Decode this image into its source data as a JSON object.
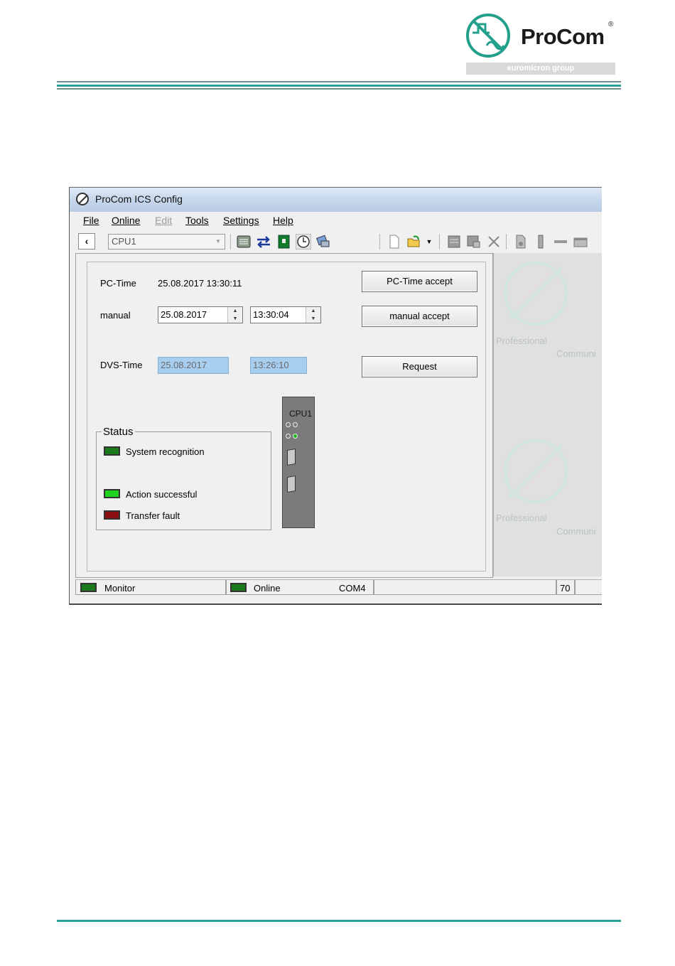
{
  "document": {
    "logo_name": "ProCom",
    "logo_reg": "®",
    "logo_group": "euromicron group"
  },
  "window": {
    "title": "ProCom ICS Config",
    "menu": [
      {
        "label": "File",
        "enabled": true
      },
      {
        "label": "Online",
        "enabled": true
      },
      {
        "label": "Edit",
        "enabled": false
      },
      {
        "label": "Tools",
        "enabled": true
      },
      {
        "label": "Settings",
        "enabled": true
      },
      {
        "label": "Help",
        "enabled": true
      }
    ],
    "toolbar": {
      "back_glyph": "‹",
      "device_combo": "CPU1",
      "icons": [
        "list-icon",
        "transfer-arrows-icon",
        "module-icon",
        "clock-icon",
        "network-icon",
        "new-file-icon",
        "open-folder-icon",
        "dropdown-arrow-icon",
        "print-icon",
        "print-preview-icon",
        "delete-icon",
        "settings-icon",
        "ruler-icon",
        "minimize-icon",
        "window-icon"
      ]
    }
  },
  "time_panel": {
    "pc_time_label": "PC-Time",
    "pc_time_value": "25.08.2017 13:30:11",
    "manual_label": "manual",
    "manual_date": "25.08.2017",
    "manual_time": "13:30:04",
    "dvs_label": "DVS-Time",
    "dvs_date": "25.08.2017",
    "dvs_time": "13:26:10",
    "pc_time_accept_button": "PC-Time accept",
    "manual_accept_button": "manual accept",
    "request_button": "Request"
  },
  "status": {
    "title": "Status",
    "items": [
      {
        "label": "System recognition",
        "led": "darkgreen"
      },
      {
        "label": "Action successful",
        "led": "green"
      },
      {
        "label": "Transfer fault",
        "led": "red"
      }
    ]
  },
  "cpu_module": {
    "label": "CPU1"
  },
  "watermark": {
    "line1": "Professional",
    "line2": "Communi"
  },
  "statusbar": {
    "monitor": "Monitor",
    "online": "Online",
    "port": "COM4",
    "number": "70"
  },
  "colors": {
    "brand_teal": "#2aa198",
    "led_green": "#1fd21f",
    "led_red": "#8c1010",
    "readonly_field": "#a7cdef"
  }
}
